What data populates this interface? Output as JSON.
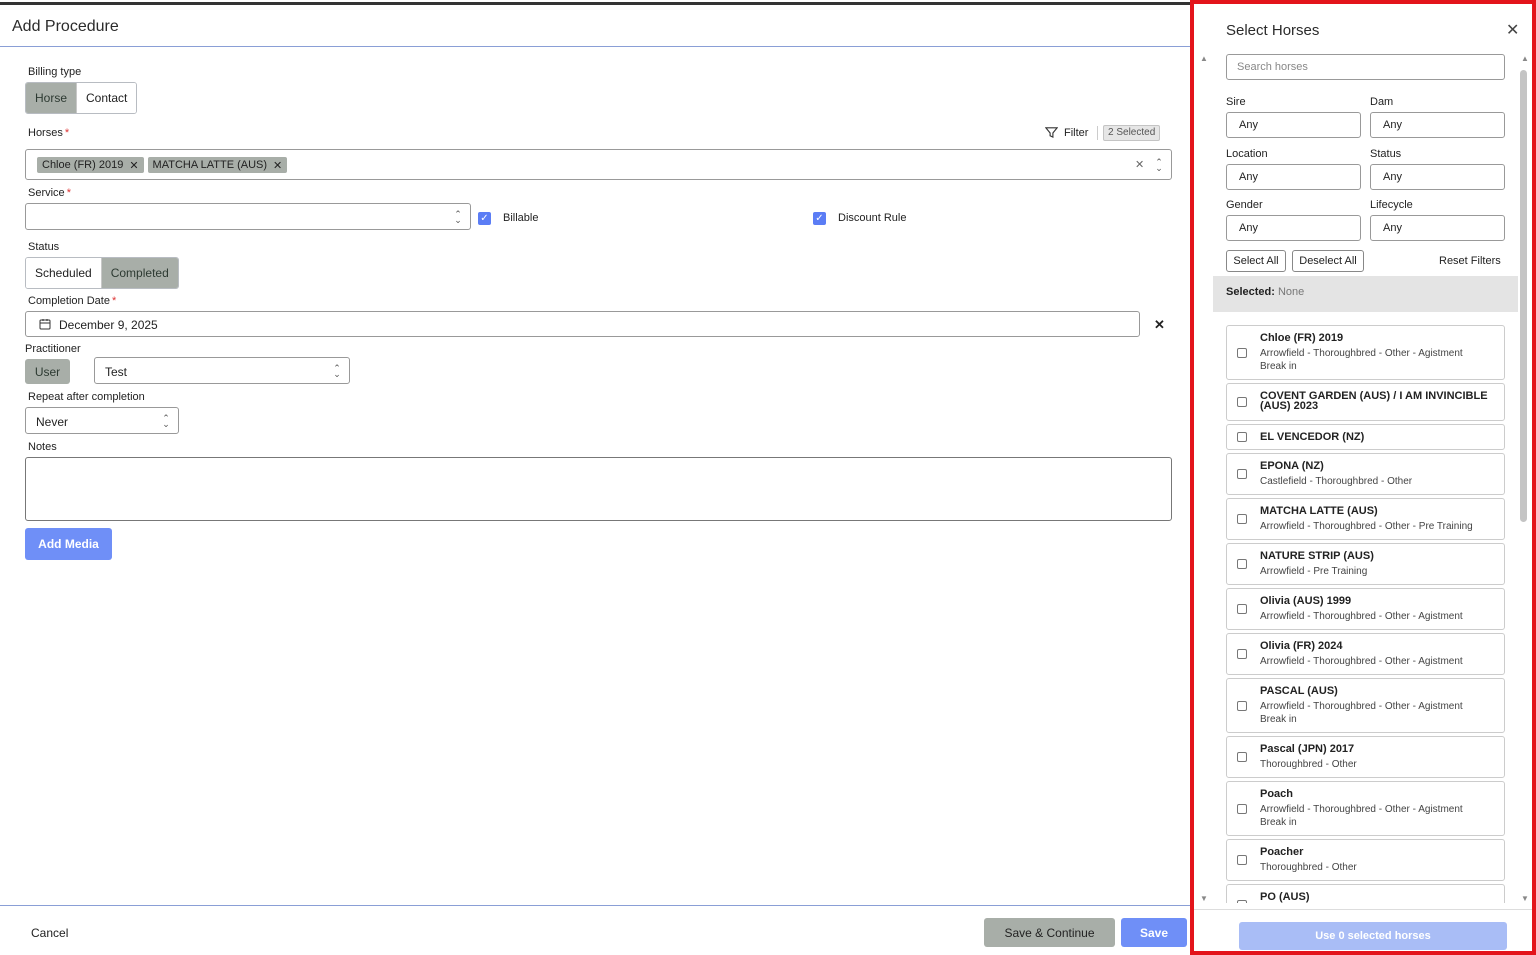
{
  "dialog": {
    "title": "Add Procedure",
    "billing_type": {
      "label": "Billing type",
      "options": [
        "Horse",
        "Contact"
      ],
      "selected": "Horse"
    },
    "horses": {
      "label": "Horses",
      "filter_label": "Filter",
      "selected_badge": "2 Selected",
      "chips": [
        {
          "label": "Chloe (FR) 2019"
        },
        {
          "label": "MATCHA LATTE (AUS)"
        }
      ]
    },
    "service": {
      "label": "Service",
      "value": "",
      "billable_label": "Billable",
      "discount_label": "Discount Rule"
    },
    "status": {
      "label": "Status",
      "options": [
        "Scheduled",
        "Completed"
      ],
      "selected": "Completed"
    },
    "completion_date": {
      "label": "Completion Date",
      "value": "December 9, 2025"
    },
    "practitioner": {
      "label": "Practitioner",
      "toggle": "User",
      "value": "Test"
    },
    "repeat": {
      "label": "Repeat after completion",
      "value": "Never"
    },
    "notes": {
      "label": "Notes",
      "value": ""
    },
    "add_media": "Add Media",
    "footer": {
      "cancel": "Cancel",
      "save_continue": "Save & Continue",
      "save": "Save"
    }
  },
  "panel": {
    "title": "Select Horses",
    "search_placeholder": "Search horses",
    "filters": [
      {
        "label": "Sire",
        "value": "Any"
      },
      {
        "label": "Dam",
        "value": "Any"
      },
      {
        "label": "Location",
        "value": "Any"
      },
      {
        "label": "Status",
        "value": "Any"
      },
      {
        "label": "Gender",
        "value": "Any"
      },
      {
        "label": "Lifecycle",
        "value": "Any"
      }
    ],
    "select_all": "Select All",
    "deselect_all": "Deselect All",
    "reset_filters": "Reset Filters",
    "selected_label": "Selected:",
    "selected_value": "None",
    "horses": [
      {
        "name": "Chloe (FR) 2019",
        "detail": "Arrowfield - Thoroughbred - Other - Agistment",
        "detail2": "Break in"
      },
      {
        "name": "COVENT GARDEN (AUS) / I AM INVINCIBLE (AUS) 2023",
        "detail": "",
        "detail2": ""
      },
      {
        "name": "EL VENCEDOR (NZ)",
        "detail": "",
        "detail2": ""
      },
      {
        "name": "EPONA (NZ)",
        "detail": "Castlefield - Thoroughbred - Other",
        "detail2": ""
      },
      {
        "name": "MATCHA LATTE (AUS)",
        "detail": "Arrowfield - Thoroughbred - Other - Pre Training",
        "detail2": ""
      },
      {
        "name": "NATURE STRIP (AUS)",
        "detail": "Arrowfield - Pre Training",
        "detail2": ""
      },
      {
        "name": "Olivia (AUS) 1999",
        "detail": "Arrowfield - Thoroughbred - Other - Agistment",
        "detail2": ""
      },
      {
        "name": "Olivia (FR) 2024",
        "detail": "Arrowfield - Thoroughbred - Other - Agistment",
        "detail2": ""
      },
      {
        "name": "PASCAL (AUS)",
        "detail": "Arrowfield - Thoroughbred - Other - Agistment",
        "detail2": "Break in"
      },
      {
        "name": "Pascal (JPN) 2017",
        "detail": "Thoroughbred - Other",
        "detail2": ""
      },
      {
        "name": "Poach",
        "detail": "Arrowfield - Thoroughbred - Other - Agistment",
        "detail2": "Break in"
      },
      {
        "name": "Poacher",
        "detail": "Thoroughbred - Other",
        "detail2": ""
      },
      {
        "name": "PO (AUS)",
        "detail": "",
        "detail2": ""
      }
    ],
    "use_button": "Use 0 selected horses"
  }
}
